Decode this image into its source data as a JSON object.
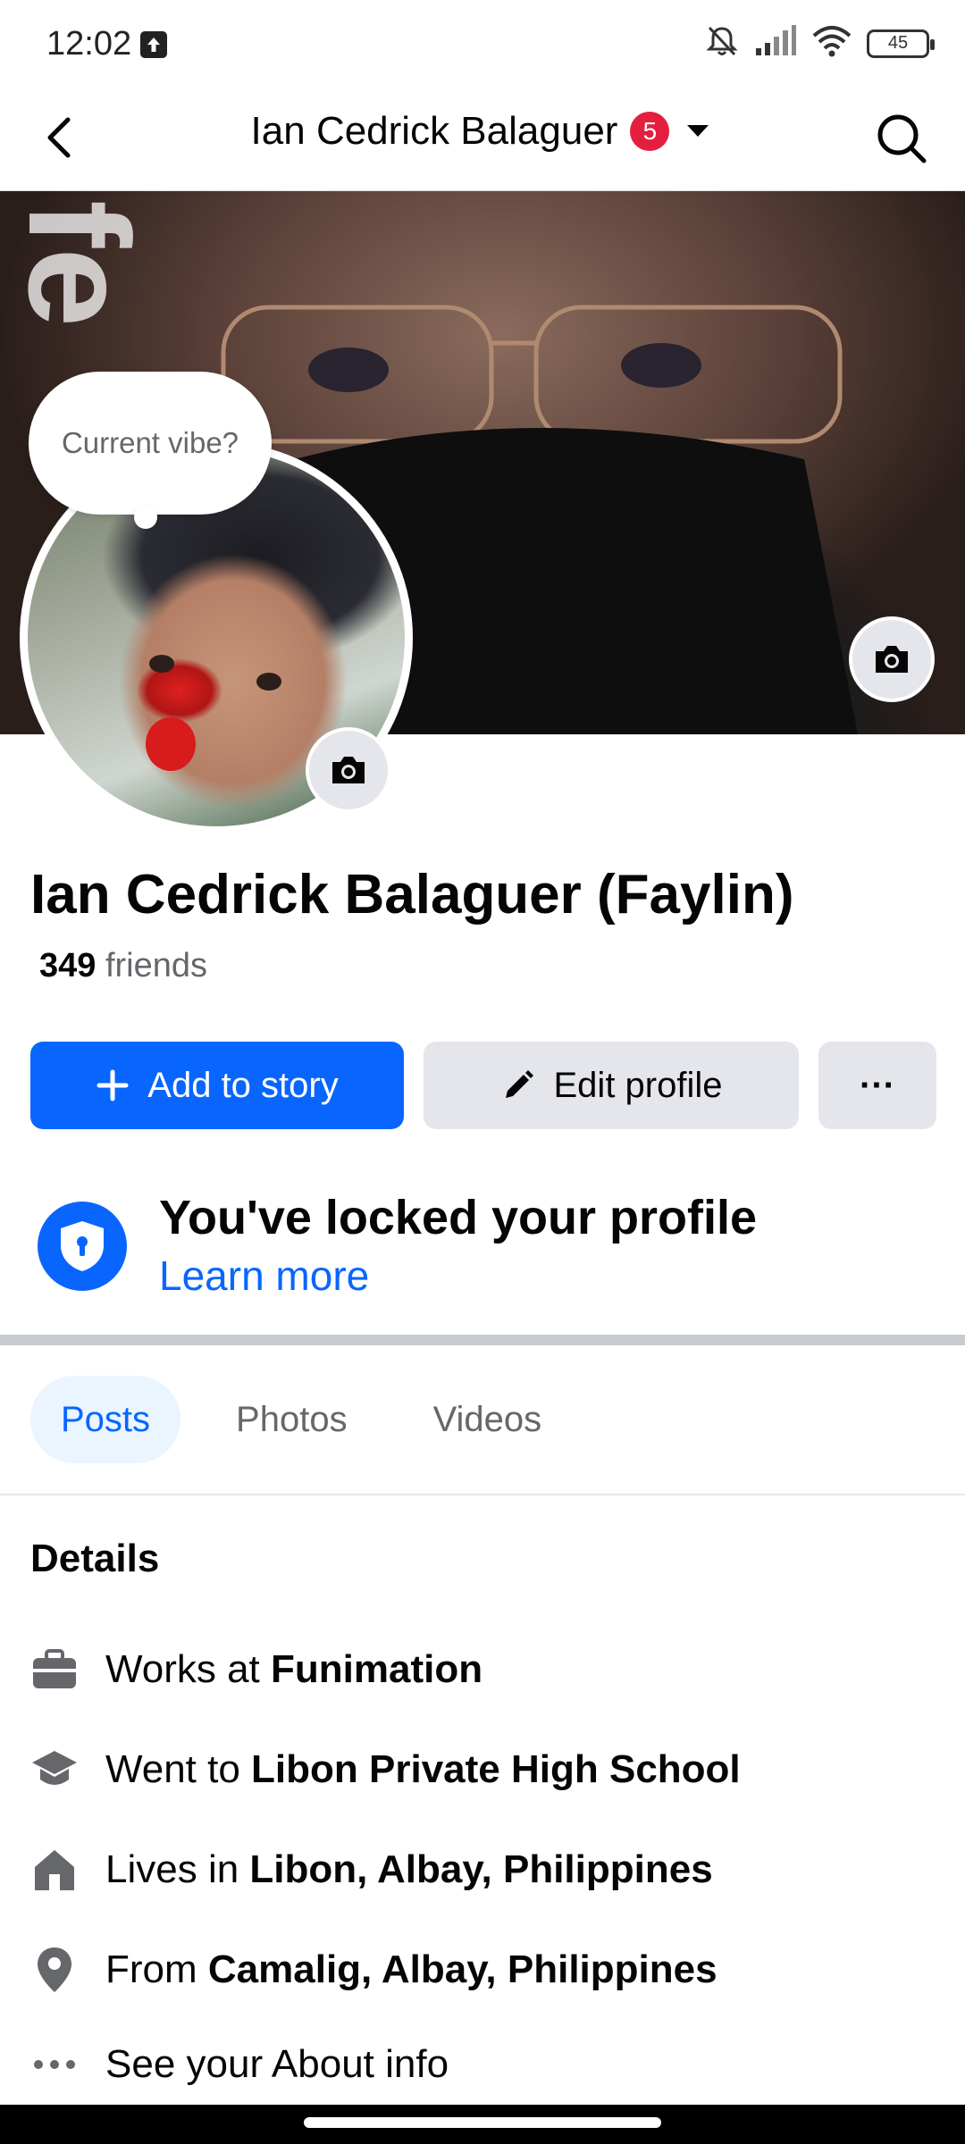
{
  "status_bar": {
    "time": "12:02",
    "battery": "45"
  },
  "header": {
    "title": "Ian Cedrick Balaguer",
    "notification_count": "5"
  },
  "cover": {
    "overlay_text": "fe"
  },
  "vibe_prompt": "Current vibe?",
  "profile": {
    "name": "Ian Cedrick Balaguer (Faylin)",
    "friends_count": "349",
    "friends_label": "friends"
  },
  "actions": {
    "add_to_story": "Add to story",
    "edit_profile": "Edit profile",
    "more": "···"
  },
  "locked": {
    "title": "You've locked your profile",
    "link": "Learn more"
  },
  "tabs": [
    {
      "label": "Posts",
      "active": true
    },
    {
      "label": "Photos",
      "active": false
    },
    {
      "label": "Videos",
      "active": false
    }
  ],
  "details": {
    "title": "Details",
    "items": [
      {
        "icon": "briefcase-icon",
        "prefix": "Works at ",
        "value": "Funimation"
      },
      {
        "icon": "graduation-cap-icon",
        "prefix": "Went to ",
        "value": "Libon Private High School"
      },
      {
        "icon": "house-icon",
        "prefix": "Lives in ",
        "value": "Libon, Albay, Philippines"
      },
      {
        "icon": "location-pin-icon",
        "prefix": "From ",
        "value": "Camalig, Albay, Philippines"
      },
      {
        "icon": "more-dots-icon",
        "prefix": "See your About info",
        "value": ""
      }
    ]
  },
  "colors": {
    "primary": "#0866ff",
    "badge": "#e41e3f",
    "secondary_button": "#e4e6eb"
  }
}
